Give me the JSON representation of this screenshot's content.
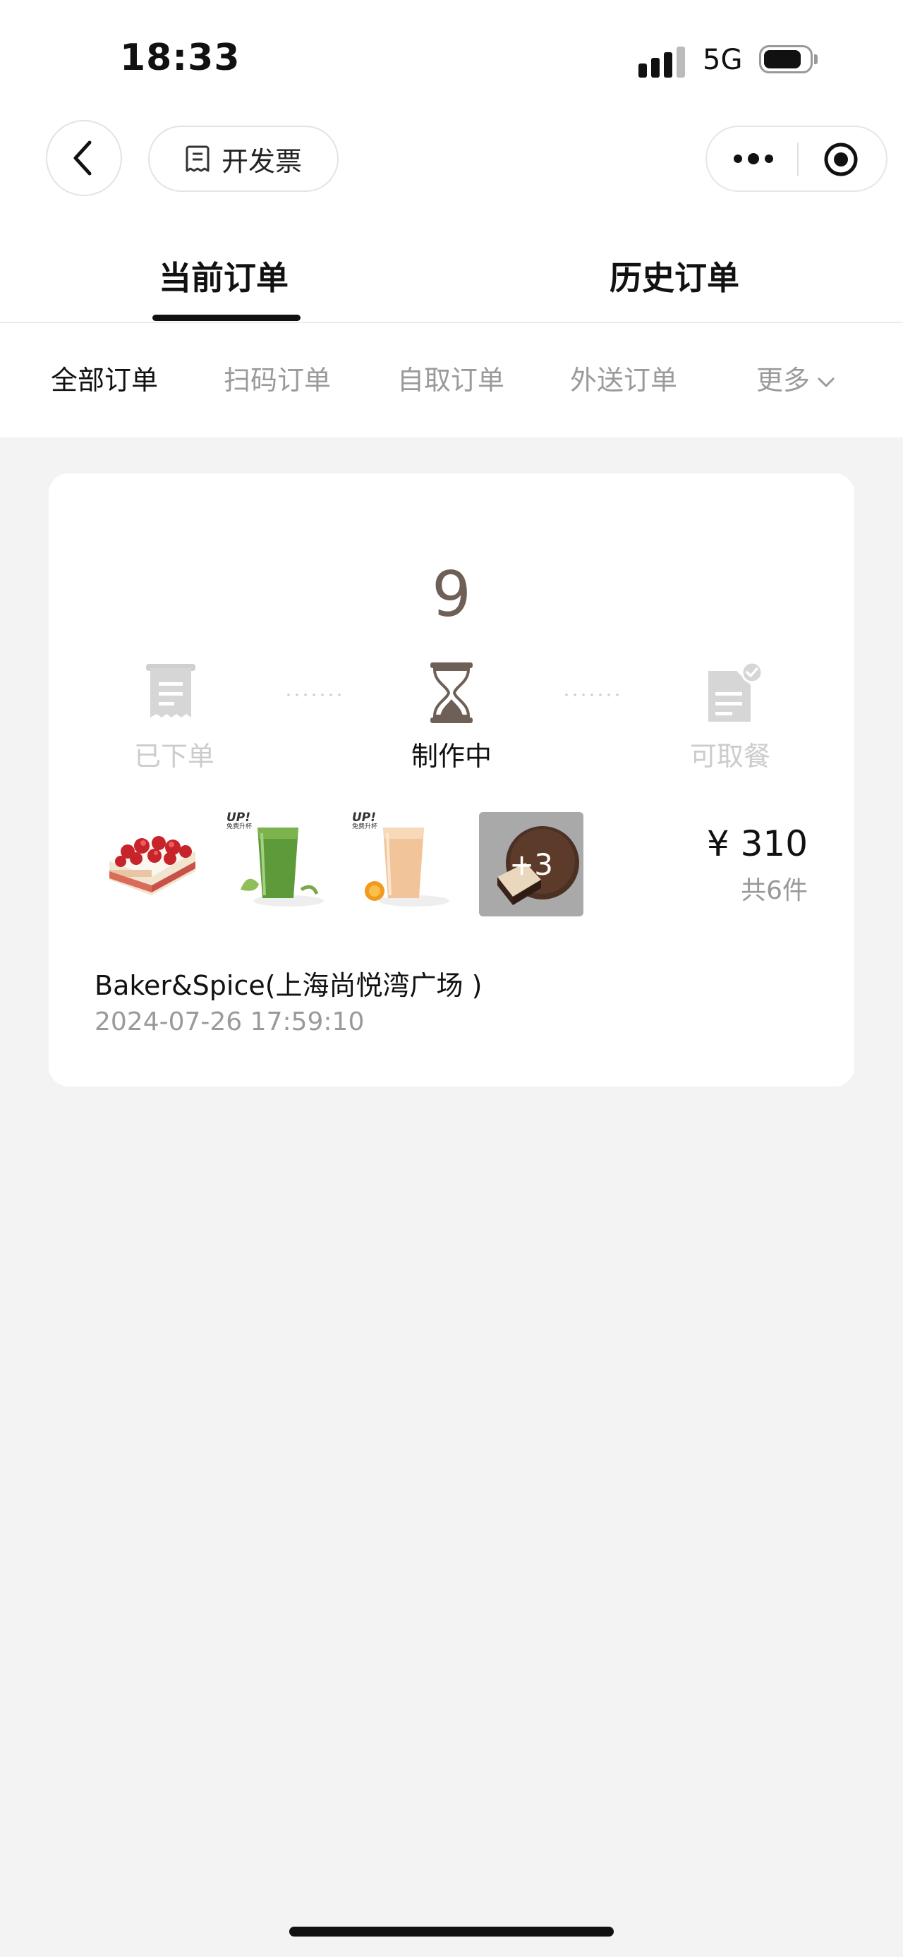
{
  "status_bar": {
    "time": "18:33",
    "network": "5G"
  },
  "nav": {
    "invoice_label": "开发票"
  },
  "tabs": [
    {
      "label": "当前订单",
      "active": true
    },
    {
      "label": "历史订单",
      "active": false
    }
  ],
  "filters": [
    {
      "label": "全部订单",
      "active": true
    },
    {
      "label": "扫码订单",
      "active": false
    },
    {
      "label": "自取订单",
      "active": false
    },
    {
      "label": "外送订单",
      "active": false
    },
    {
      "label": "更多",
      "active": false
    }
  ],
  "order": {
    "queue_number": "9",
    "steps": [
      {
        "label": "已下单",
        "state": "done"
      },
      {
        "label": "制作中",
        "state": "current"
      },
      {
        "label": "可取餐",
        "state": "pending"
      }
    ],
    "extra_items": "+3",
    "price": "¥ 310",
    "item_count": "共6件",
    "store": "Baker&Spice(上海尚悦湾广场 )",
    "datetime": "2024-07-26 17:59:10",
    "badges": {
      "up": "UP!",
      "sub": "免费升杯"
    }
  },
  "colors": {
    "brand": "#6e5f57",
    "inactive": "#cccccc"
  }
}
